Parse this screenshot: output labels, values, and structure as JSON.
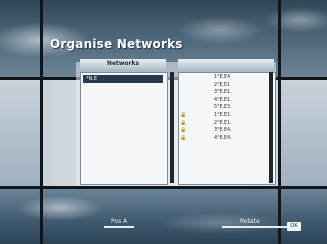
{
  "header": {
    "title": "Organise Networks"
  },
  "columns": {
    "left": "Networks",
    "right": ""
  },
  "networks": {
    "selected": "*N.E"
  },
  "satellites": [
    {
      "name": "1°E.E4",
      "locked": false
    },
    {
      "name": "2°E.E1",
      "locked": false
    },
    {
      "name": "3°E.E1.",
      "locked": false
    },
    {
      "name": "4°E.E1.",
      "locked": false
    },
    {
      "name": "5°E.E3.",
      "locked": false
    },
    {
      "name": "1°E.E1.",
      "locked": true
    },
    {
      "name": "2°E.E1.",
      "locked": true
    },
    {
      "name": "3°E.E4.",
      "locked": true
    },
    {
      "name": "4°E.E4.",
      "locked": true
    }
  ],
  "footer": {
    "left_label": "Pos A",
    "right_label": "Rotate",
    "ok_label": "OK"
  }
}
